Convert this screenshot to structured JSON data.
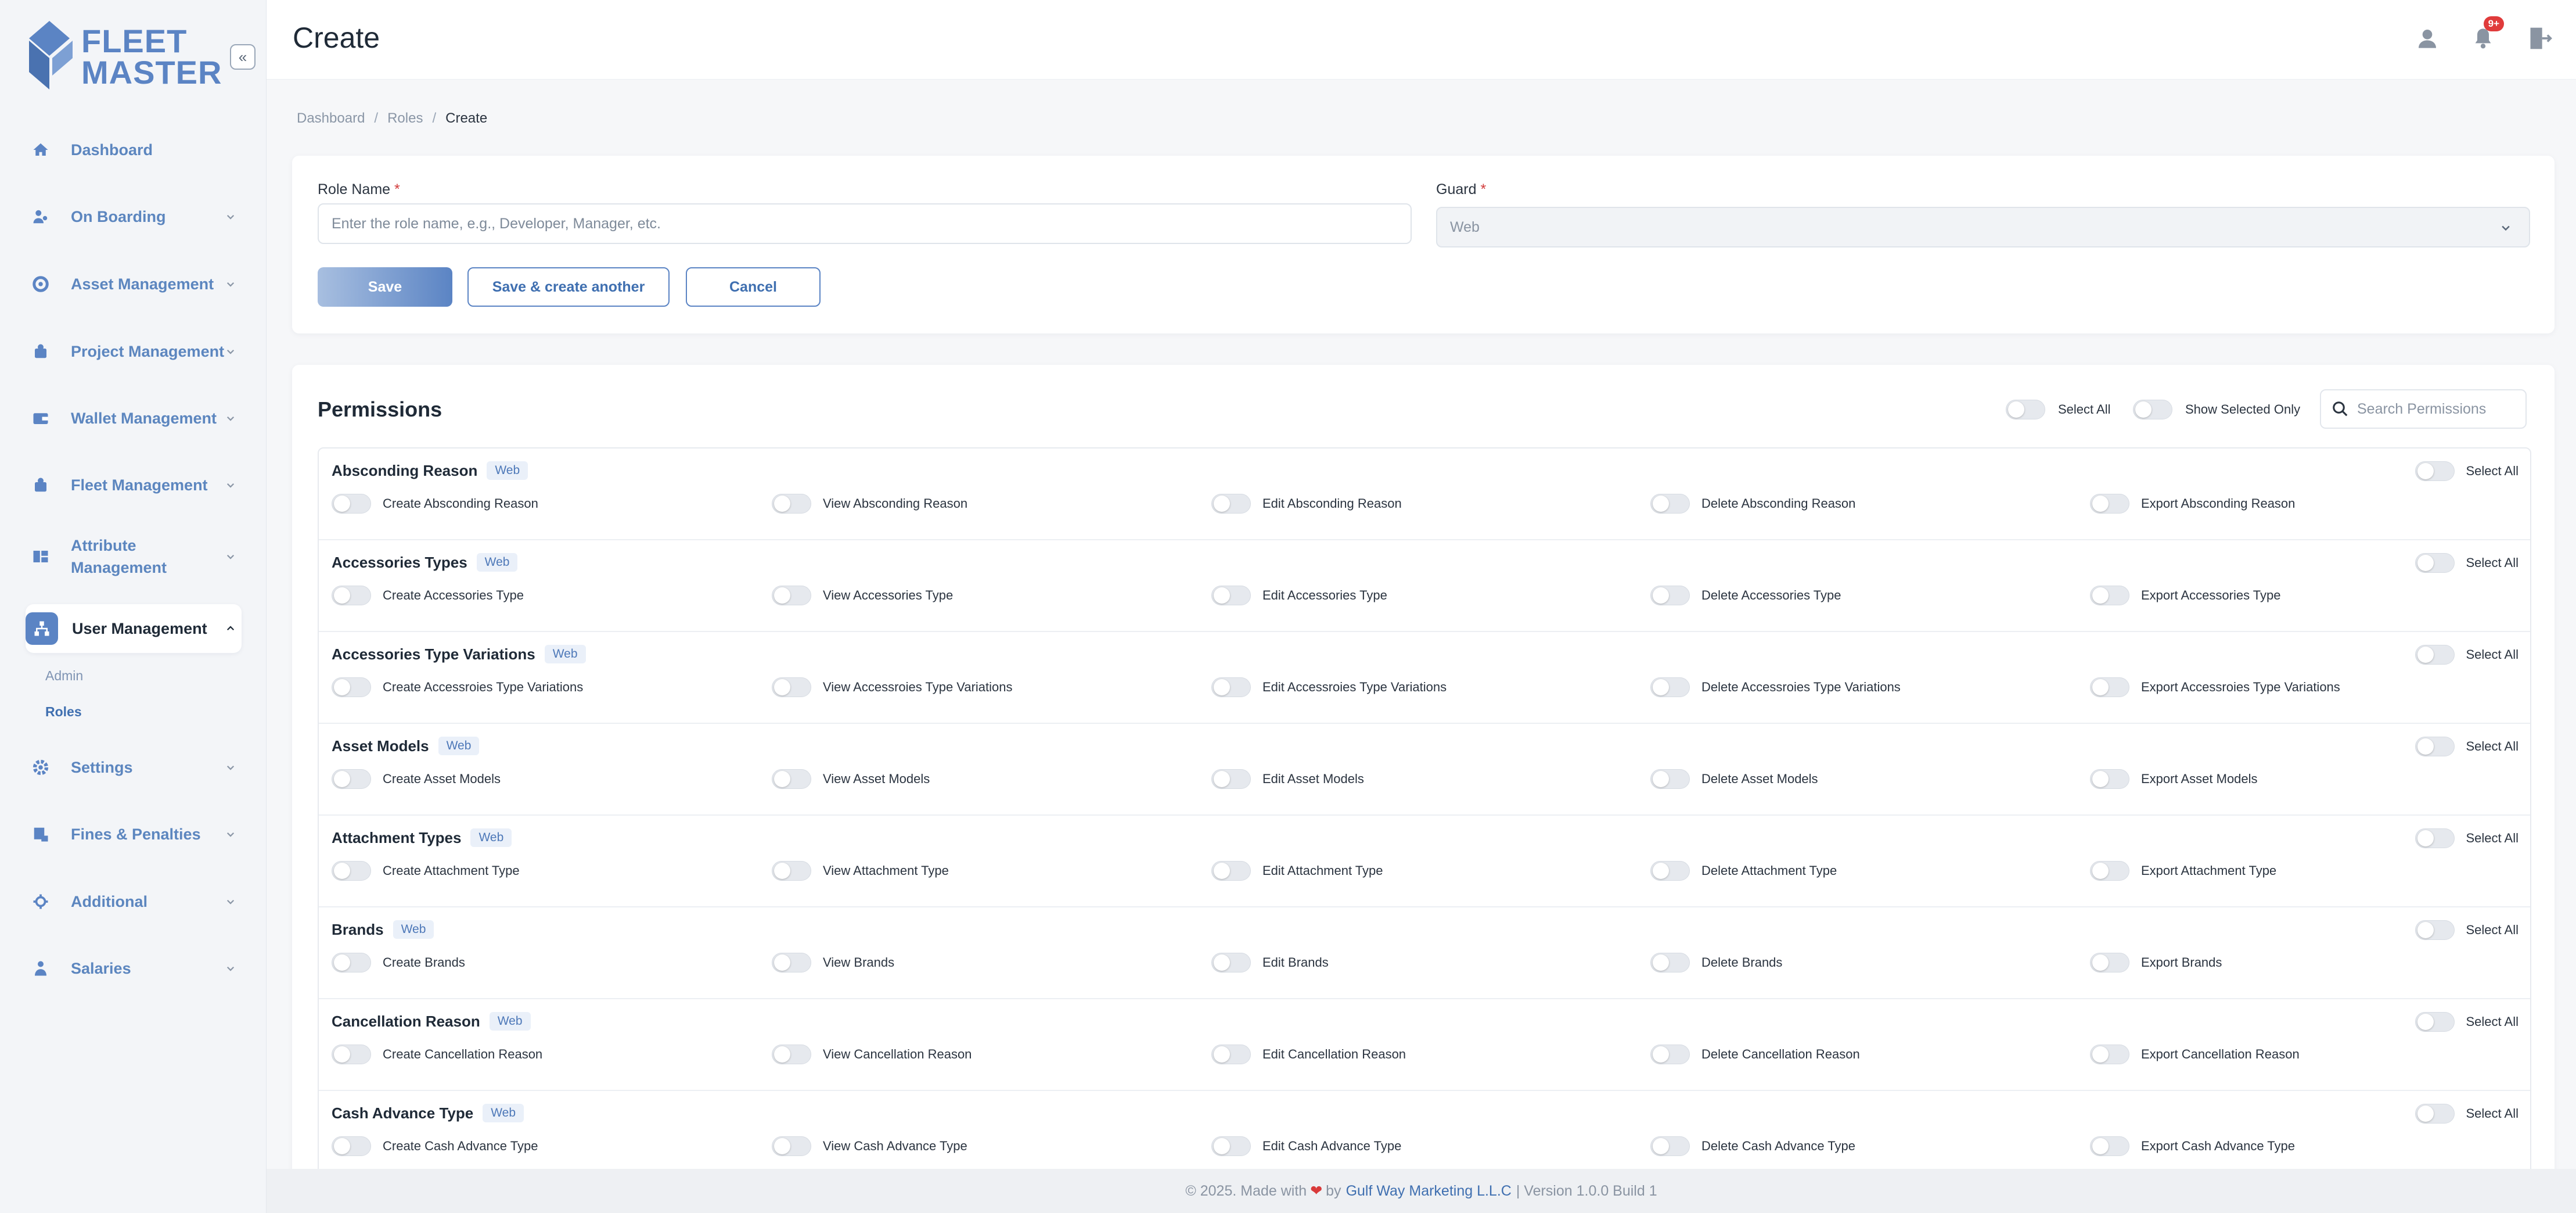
{
  "app": {
    "logo_text": "FLEET\nMASTER"
  },
  "header": {
    "title": "Create",
    "notification_count": "9+"
  },
  "sidebar": {
    "items": [
      {
        "label": "Dashboard",
        "icon": "home-icon"
      },
      {
        "label": "On Boarding",
        "icon": "onboarding-icon"
      },
      {
        "label": "Asset Management",
        "icon": "asset-icon"
      },
      {
        "label": "Project Management",
        "icon": "project-icon"
      },
      {
        "label": "Wallet Management",
        "icon": "wallet-icon"
      },
      {
        "label": "Fleet Management",
        "icon": "fleet-icon"
      },
      {
        "label": "Attribute Management",
        "icon": "attribute-icon"
      },
      {
        "label": "User Management",
        "icon": "users-icon"
      },
      {
        "label": "Settings",
        "icon": "gear-icon"
      },
      {
        "label": "Fines & Penalties",
        "icon": "fines-icon"
      },
      {
        "label": "Additional",
        "icon": "additional-icon"
      },
      {
        "label": "Salaries",
        "icon": "salaries-icon"
      }
    ],
    "sub_items": [
      {
        "label": "Admin"
      },
      {
        "label": "Roles"
      }
    ]
  },
  "breadcrumb": {
    "items": [
      "Dashboard",
      "Roles",
      "Create"
    ]
  },
  "form": {
    "role_name_label": "Role Name",
    "role_name_placeholder": "Enter the role name, e.g., Developer, Manager, etc.",
    "guard_label": "Guard",
    "guard_value": "Web",
    "save_label": "Save",
    "save_another_label": "Save & create another",
    "cancel_label": "Cancel"
  },
  "permissions": {
    "title": "Permissions",
    "select_all_label": "Select All",
    "show_selected_label": "Show Selected Only",
    "search_placeholder": "Search Permissions",
    "web_tag": "Web",
    "groups": [
      {
        "name": "Absconding Reason",
        "opts": [
          "Create Absconding Reason",
          "View Absconding Reason",
          "Edit Absconding Reason",
          "Delete Absconding Reason",
          "Export Absconding Reason"
        ]
      },
      {
        "name": "Accessories Types",
        "opts": [
          "Create Accessories Type",
          "View Accessories Type",
          "Edit Accessories Type",
          "Delete Accessories Type",
          "Export Accessories Type"
        ]
      },
      {
        "name": "Accessories Type Variations",
        "opts": [
          "Create Accessroies Type Variations",
          "View Accessroies Type Variations",
          "Edit Accessroies Type Variations",
          "Delete Accessroies Type Variations",
          "Export Accessroies Type Variations"
        ]
      },
      {
        "name": "Asset Models",
        "opts": [
          "Create Asset Models",
          "View Asset Models",
          "Edit Asset Models",
          "Delete Asset Models",
          "Export Asset Models"
        ]
      },
      {
        "name": "Attachment Types",
        "opts": [
          "Create Attachment Type",
          "View Attachment Type",
          "Edit Attachment Type",
          "Delete Attachment Type",
          "Export Attachment Type"
        ]
      },
      {
        "name": "Brands",
        "opts": [
          "Create Brands",
          "View Brands",
          "Edit Brands",
          "Delete Brands",
          "Export Brands"
        ]
      },
      {
        "name": "Cancellation Reason",
        "opts": [
          "Create Cancellation Reason",
          "View Cancellation Reason",
          "Edit Cancellation Reason",
          "Delete Cancellation Reason",
          "Export Cancellation Reason"
        ]
      },
      {
        "name": "Cash Advance Type",
        "opts": [
          "Create Cash Advance Type",
          "View Cash Advance Type",
          "Edit Cash Advance Type",
          "Delete Cash Advance Type",
          "Export Cash Advance Type"
        ]
      }
    ]
  },
  "footer": {
    "prefix": "© 2025. Made with",
    "by": "by",
    "company": "Gulf Way Marketing L.L.C",
    "version": "| Version 1.0.0 Build 1"
  }
}
